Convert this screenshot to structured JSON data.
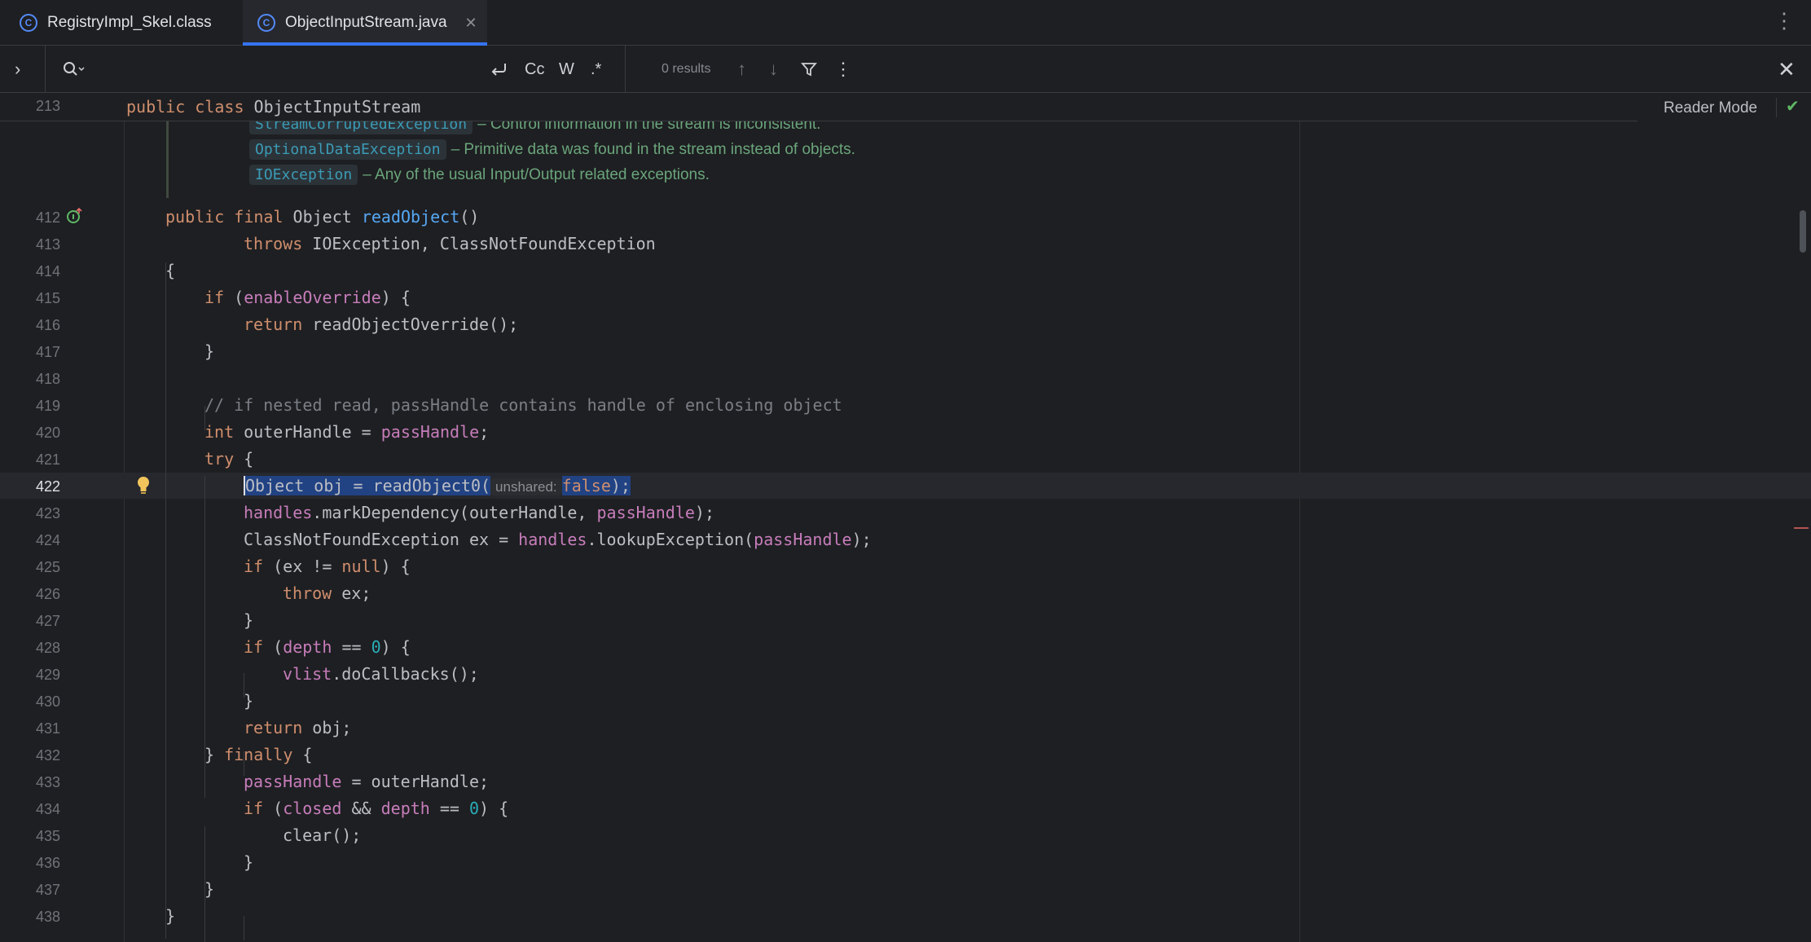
{
  "tabs": [
    {
      "label": "RegistryImpl_Skel.class",
      "active": false
    },
    {
      "label": "ObjectInputStream.java",
      "active": true
    }
  ],
  "find": {
    "expand_icon": "chevron-right-icon",
    "search_icon": "search-icon",
    "results": "0 results",
    "match_case": "Cc",
    "words": "W",
    "regex": ".*"
  },
  "sticky": {
    "line": "213",
    "code_kw": "public class",
    "code_name": "ObjectInputStream"
  },
  "reader_mode": "Reader Mode",
  "doc": [
    {
      "link": "StreamCorruptedException",
      "text": "– Control information in the stream is inconsistent."
    },
    {
      "link": "OptionalDataException",
      "text": "– Primitive data was found in the stream instead of objects."
    },
    {
      "link": "IOException",
      "text": "– Any of the usual Input/Output related exceptions."
    }
  ],
  "line_numbers": [
    "412",
    "413",
    "414",
    "415",
    "416",
    "417",
    "418",
    "419",
    "420",
    "421",
    "422",
    "423",
    "424",
    "425",
    "426",
    "427",
    "428",
    "429",
    "430",
    "431",
    "432",
    "433",
    "434",
    "435",
    "436",
    "437",
    "438"
  ],
  "current_line": "422",
  "code": {
    "l412": {
      "kw": "public final",
      "t1": " Object ",
      "fn": "readObject",
      "t2": "()"
    },
    "l413": {
      "kw": "throws",
      "t": " IOException, ClassNotFoundException"
    },
    "l414": "{",
    "l415": {
      "kw": "if",
      "t1": " (",
      "fld": "enableOverride",
      "t2": ") {"
    },
    "l416": {
      "kw": "return",
      "t": " readObjectOverride();"
    },
    "l417": "}",
    "l419": "// if nested read, passHandle contains handle of enclosing object",
    "l420": {
      "kw": "int",
      "t1": " outerHandle = ",
      "fld": "passHandle",
      "t2": ";"
    },
    "l421": {
      "kw": "try",
      "t": " {"
    },
    "l422": {
      "t1": "Object obj = readObject0(",
      "hint": "unshared:",
      "kw": "false",
      "t2": ");"
    },
    "l423": {
      "fld1": "handles",
      "t1": ".markDependency(outerHandle, ",
      "fld2": "passHandle",
      "t2": ");"
    },
    "l424": {
      "t1": "ClassNotFoundException ex = ",
      "fld1": "handles",
      "t2": ".lookupException(",
      "fld2": "passHandle",
      "t3": ");"
    },
    "l425": {
      "kw1": "if",
      "t1": " (ex != ",
      "kw2": "null",
      "t2": ") {"
    },
    "l426": {
      "kw": "throw",
      "t": " ex;"
    },
    "l427": "}",
    "l428": {
      "kw": "if",
      "t1": " (",
      "fld": "depth",
      "t2": " == ",
      "num": "0",
      "t3": ") {"
    },
    "l429": {
      "fld": "vlist",
      "t": ".doCallbacks();"
    },
    "l430": "}",
    "l431": {
      "kw": "return",
      "t": " obj;"
    },
    "l432": {
      "t1": "} ",
      "kw": "finally",
      "t2": " {"
    },
    "l433": {
      "fld": "passHandle",
      "t": " = outerHandle;"
    },
    "l434": {
      "kw": "if",
      "t1": " (",
      "fld1": "closed",
      "t2": " && ",
      "fld2": "depth",
      "t3": " == ",
      "num": "0",
      "t4": ") {"
    },
    "l435": "clear();",
    "l436": "}",
    "l437": "}",
    "l438": "}"
  },
  "colors": {
    "background": "#1e1f22",
    "keyword": "#cf8e6d",
    "function": "#56a8f5",
    "field": "#c77dbb",
    "number": "#2aacb8",
    "selection": "#214283",
    "accent": "#3574f0"
  }
}
